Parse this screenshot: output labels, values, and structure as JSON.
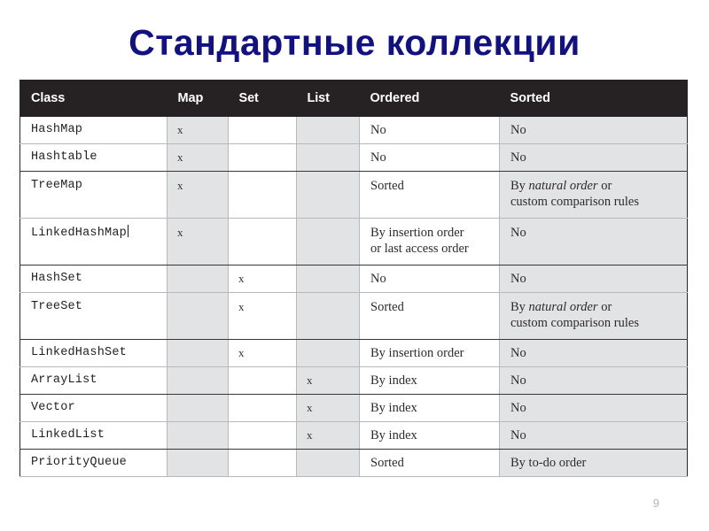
{
  "slide": {
    "title": "Стандартные коллекции",
    "page_number": "9",
    "title_color": "#111184",
    "header_bg": "#262122",
    "shaded_column_color": "#e2e3e5"
  },
  "table": {
    "columns": [
      {
        "key": "class",
        "label": "Class",
        "shaded": false
      },
      {
        "key": "map",
        "label": "Map",
        "shaded": true
      },
      {
        "key": "set",
        "label": "Set",
        "shaded": false
      },
      {
        "key": "list",
        "label": "List",
        "shaded": true
      },
      {
        "key": "ordered",
        "label": "Ordered",
        "shaded": false
      },
      {
        "key": "sorted",
        "label": "Sorted",
        "shaded": true
      }
    ],
    "rows": [
      {
        "class": "HashMap",
        "map": "x",
        "set": "",
        "list": "",
        "ordered": "No",
        "sorted": "No"
      },
      {
        "class": "Hashtable",
        "map": "x",
        "set": "",
        "list": "",
        "ordered": "No",
        "sorted": "No"
      },
      {
        "class": "TreeMap",
        "map": "x",
        "set": "",
        "list": "",
        "ordered": "Sorted",
        "sorted_line1_prefix": "By ",
        "sorted_line1_italic": "natural order",
        "sorted_line1_suffix": " or",
        "sorted_line2": "custom comparison rules"
      },
      {
        "class": "LinkedHashMap",
        "map": "x",
        "set": "",
        "list": "",
        "ordered_line1": "By insertion order",
        "ordered_line2": "or last access order",
        "sorted": "No"
      },
      {
        "class": "HashSet",
        "map": "",
        "set": "x",
        "list": "",
        "ordered": "No",
        "sorted": "No"
      },
      {
        "class": "TreeSet",
        "map": "",
        "set": "x",
        "list": "",
        "ordered": "Sorted",
        "sorted_line1_prefix": "By ",
        "sorted_line1_italic": "natural order",
        "sorted_line1_suffix": " or",
        "sorted_line2": "custom comparison rules"
      },
      {
        "class": "LinkedHashSet",
        "map": "",
        "set": "x",
        "list": "",
        "ordered": "By insertion order",
        "sorted": "No"
      },
      {
        "class": "ArrayList",
        "map": "",
        "set": "",
        "list": "x",
        "ordered": "By index",
        "sorted": "No"
      },
      {
        "class": "Vector",
        "map": "",
        "set": "",
        "list": "x",
        "ordered": "By index",
        "sorted": "No"
      },
      {
        "class": "LinkedList",
        "map": "",
        "set": "",
        "list": "x",
        "ordered": "By index",
        "sorted": "No"
      },
      {
        "class": "PriorityQueue",
        "map": "",
        "set": "",
        "list": "",
        "ordered": "Sorted",
        "sorted": "By to-do order"
      }
    ]
  }
}
